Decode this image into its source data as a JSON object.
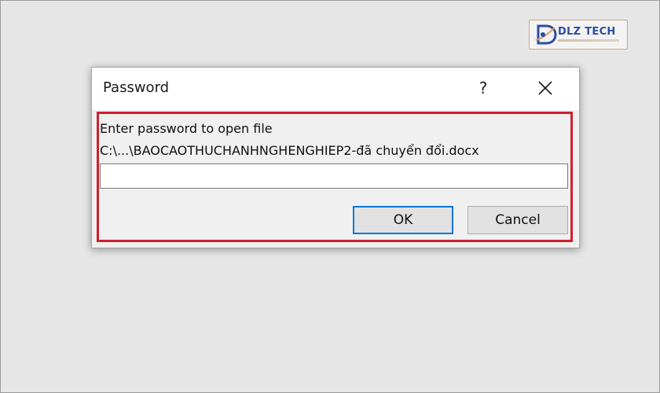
{
  "watermark": {
    "brand": "DLZ TECH",
    "icon": "dlz-tech-logo-icon"
  },
  "dialog": {
    "title": "Password",
    "help_label": "?",
    "close_icon": "close-icon",
    "prompt": "Enter password to open file",
    "file_path": "C:\\...\\BAOCAOTHUCHANHNGHENGHIEP2-đã chuyển đổi.docx",
    "password_value": "",
    "ok_label": "OK",
    "cancel_label": "Cancel"
  },
  "colors": {
    "highlight": "#d01f2f",
    "focus_border": "#0078d7",
    "brand": "#2f4ea3"
  }
}
